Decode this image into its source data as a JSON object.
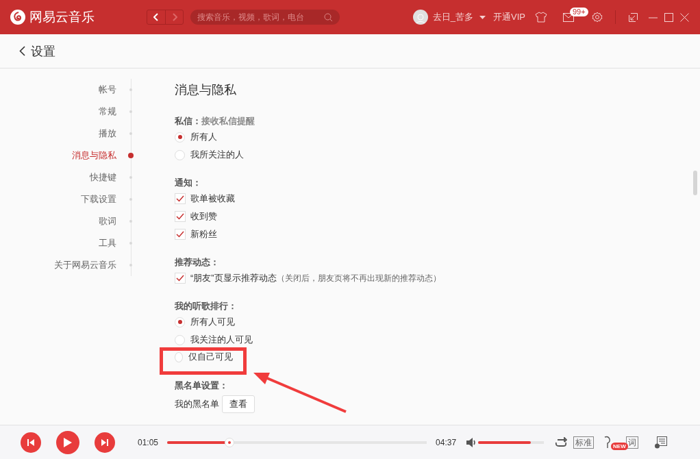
{
  "header": {
    "app_name": "网易云音乐",
    "search": {
      "placeholder": "搜索音乐，视频，歌词，电台"
    },
    "user": {
      "name": "去日_苦多"
    },
    "vip": "开通VIP",
    "mail_badge": "99+"
  },
  "page": {
    "title": "设置"
  },
  "nav": [
    {
      "label": "帐号",
      "selected": false
    },
    {
      "label": "常规",
      "selected": false
    },
    {
      "label": "播放",
      "selected": false
    },
    {
      "label": "消息与隐私",
      "selected": true
    },
    {
      "label": "快捷键",
      "selected": false
    },
    {
      "label": "下载设置",
      "selected": false
    },
    {
      "label": "歌词",
      "selected": false
    },
    {
      "label": "工具",
      "selected": false
    },
    {
      "label": "关于网易云音乐",
      "selected": false
    }
  ],
  "section_title": "消息与隐私",
  "groups": [
    {
      "kind": "radio",
      "heading": "私信：",
      "hint": "接收私信提醒",
      "options": [
        {
          "label": "所有人",
          "selected": true,
          "highlighted": false
        },
        {
          "label": "我所关注的人",
          "selected": false,
          "highlighted": false
        }
      ]
    },
    {
      "kind": "checkbox",
      "heading": "通知：",
      "options": [
        {
          "label": "歌单被收藏",
          "checked": true,
          "highlighted": false
        },
        {
          "label": "收到赞",
          "checked": true,
          "highlighted": false
        },
        {
          "label": "新粉丝",
          "checked": true,
          "highlighted": false
        }
      ]
    },
    {
      "kind": "checkbox",
      "heading": "推荐动态：",
      "options": [
        {
          "label": "“朋友”页显示推荐动态",
          "note": "（关闭后，朋友页将不再出现新的推荐动态）",
          "checked": true,
          "highlighted": false
        }
      ]
    },
    {
      "kind": "radio",
      "heading": "我的听歌排行：",
      "options": [
        {
          "label": "所有人可见",
          "selected": true,
          "highlighted": false
        },
        {
          "label": "我关注的人可见",
          "selected": false,
          "highlighted": false
        },
        {
          "label": "仅自己可见",
          "selected": false,
          "highlighted": true
        }
      ]
    },
    {
      "kind": "action",
      "heading": "黑名单设置：",
      "label": "我的黑名单",
      "button": "查看"
    }
  ],
  "player": {
    "elapsed": "01:05",
    "progress": {
      "level": 0.24
    },
    "duration": "04:37",
    "volume": {
      "level": 0.8
    },
    "quality": "标准",
    "effect_badge": "NEW",
    "lyrics": "词"
  }
}
